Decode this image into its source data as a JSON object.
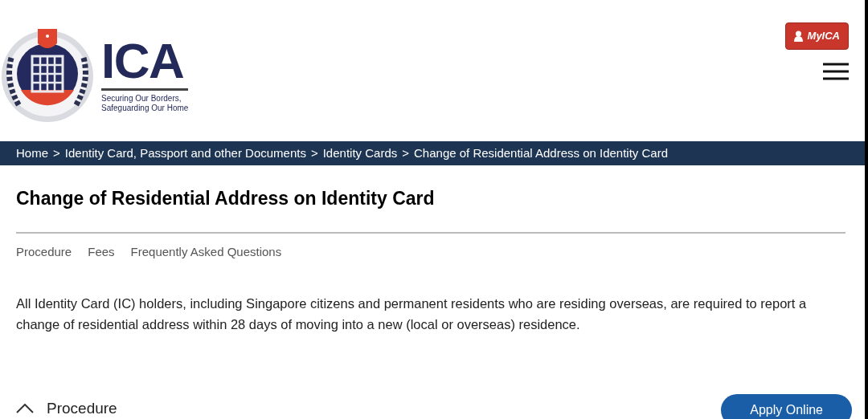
{
  "header": {
    "logo": {
      "wordmark": "ICA",
      "tagline": [
        "Securing Our Borders,",
        "Safeguarding Our Home"
      ]
    },
    "account_button": "MyICA"
  },
  "breadcrumbs": [
    "Home",
    "Identity Card, Passport and other Documents",
    "Identity Cards",
    "Change of Residential Address on Identity Card"
  ],
  "breadcrumb_separator": ">",
  "page_title": "Change of Residential Address on Identity Card",
  "section_links": [
    "Procedure",
    "Fees",
    "Frequently Asked Questions"
  ],
  "intro": "All Identity Card (IC) holders, including Singapore citizens and permanent residents who are residing overseas, are required to report a change of residential address within 28 days of moving into a new (local or overseas) residence.",
  "accordion": {
    "label": "Procedure",
    "expanded": true
  },
  "apply_button": "Apply Online"
}
